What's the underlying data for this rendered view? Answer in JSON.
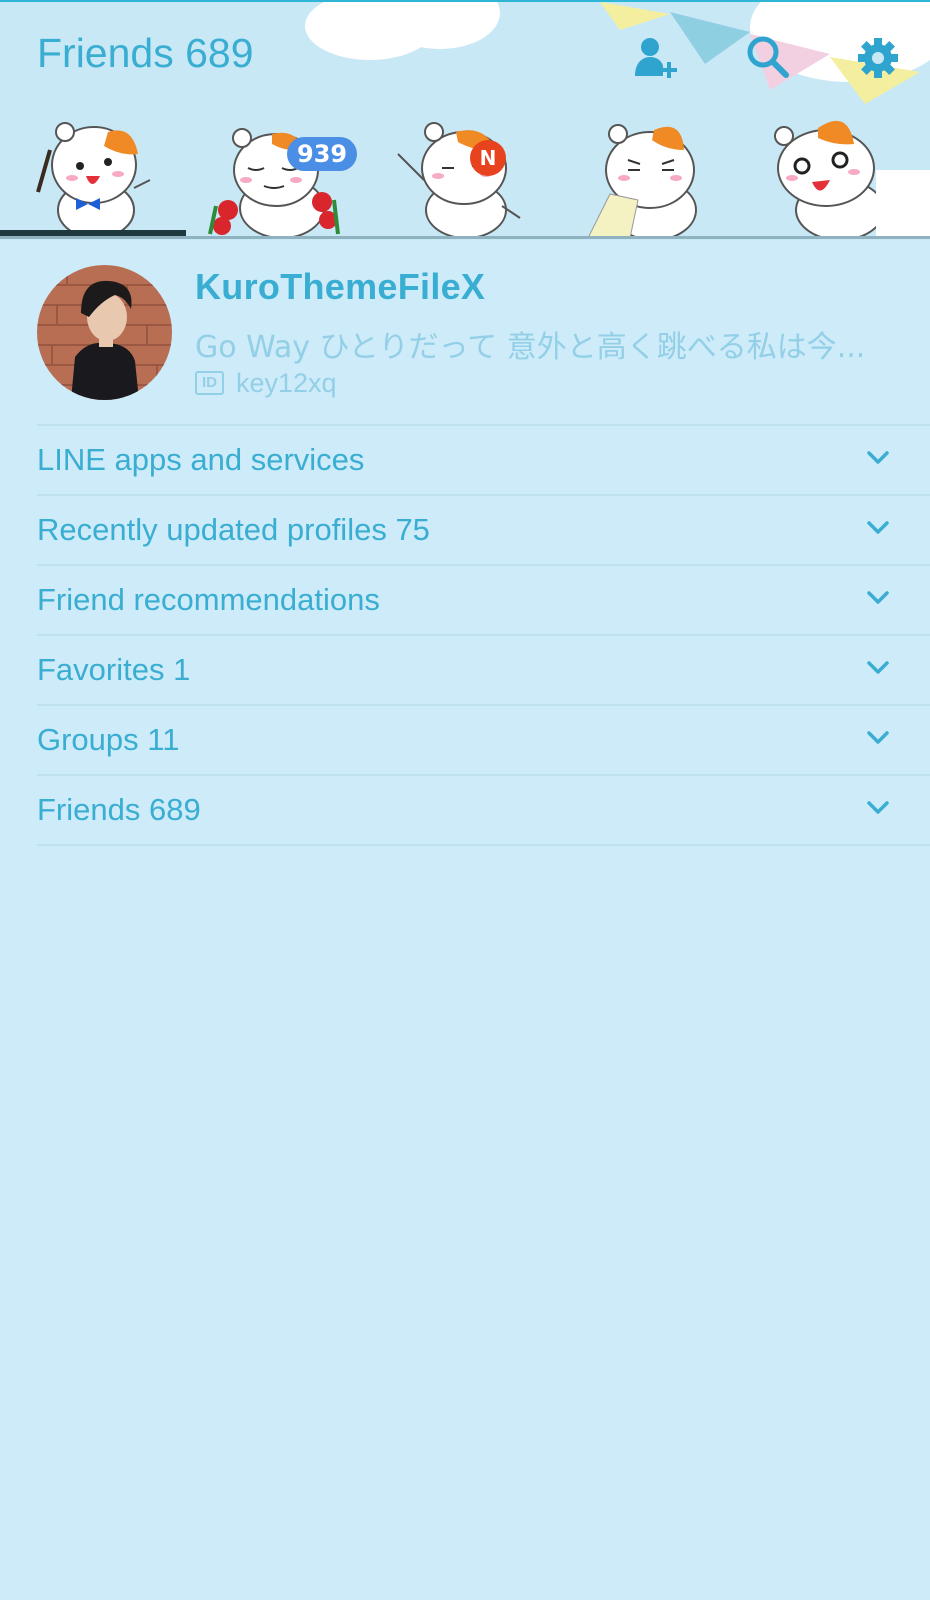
{
  "header": {
    "title": "Friends 689",
    "icons": [
      "add-friend-icon",
      "search-icon",
      "settings-icon"
    ]
  },
  "tabs": [
    {
      "name": "friends",
      "active": true
    },
    {
      "name": "chats",
      "badge": "939"
    },
    {
      "name": "timeline",
      "badge": "N"
    },
    {
      "name": "news"
    },
    {
      "name": "more"
    }
  ],
  "profile": {
    "name": "KuroThemeFileX",
    "status": "Go Way ひとりだって 意外と高く跳べる私は今...",
    "id_label": "ID",
    "id_value": "key12xq"
  },
  "sections": [
    {
      "label": "LINE apps and services"
    },
    {
      "label": "Recently updated profiles 75"
    },
    {
      "label": "Friend recommendations"
    },
    {
      "label": "Favorites 1"
    },
    {
      "label": "Groups 11"
    },
    {
      "label": "Friends 689"
    }
  ],
  "colors": {
    "accent": "#3aaed2",
    "background": "#cdebf8",
    "muted": "#93cfe7",
    "badge_blue": "#4a8ee6",
    "badge_red": "#e8431f"
  }
}
